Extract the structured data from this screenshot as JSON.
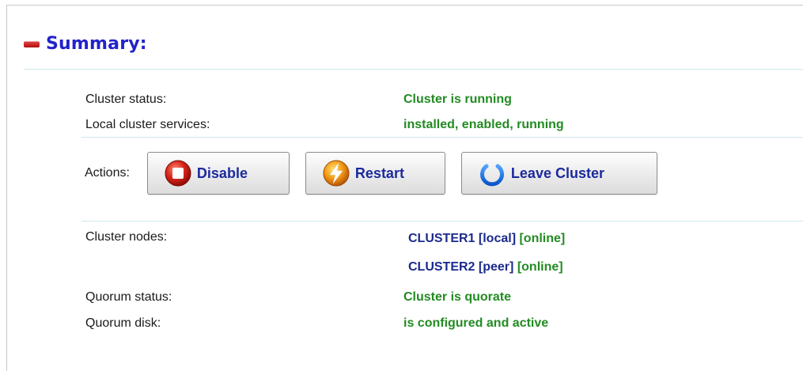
{
  "summary": {
    "title": "Summary:"
  },
  "status": {
    "cluster_status": {
      "label": "Cluster status:",
      "value": "Cluster is running"
    },
    "local_services": {
      "label": "Local cluster services:",
      "value": "installed, enabled, running"
    }
  },
  "actions": {
    "label": "Actions:",
    "disable": "Disable",
    "restart": "Restart",
    "leave": "Leave Cluster"
  },
  "nodes": {
    "label": "Cluster nodes:",
    "items": [
      {
        "name": "CLUSTER1 [local]",
        "state": "[online]"
      },
      {
        "name": "CLUSTER2 [peer]",
        "state": "[online]"
      }
    ]
  },
  "quorum": {
    "status": {
      "label": "Quorum status:",
      "value": "Cluster is quorate"
    },
    "disk": {
      "label": "Quorum disk:",
      "value": "is configured and active"
    }
  },
  "colors": {
    "title_blue": "#2222cc",
    "ok_green": "#228b22",
    "node_navy": "#1c2a8c",
    "rule": "#cfe6ee"
  }
}
